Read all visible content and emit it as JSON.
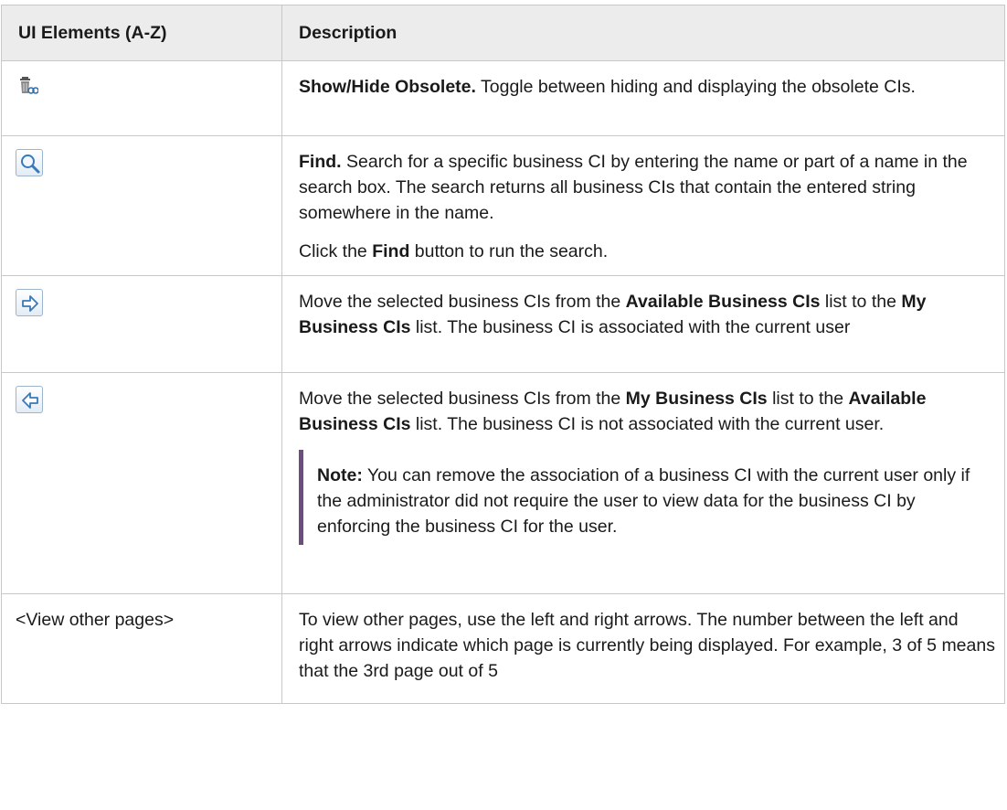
{
  "table": {
    "headers": {
      "col1": "UI Elements (A-Z)",
      "col2": "Description"
    },
    "rows": [
      {
        "icon": "show-hide-obsolete-icon",
        "term": "Show/Hide Obsolete.",
        "text": " Toggle between hiding and displaying the obsolete CIs."
      },
      {
        "icon": "find-magnifier-icon",
        "term": "Find.",
        "text": " Search for a specific business CI by entering the name or part of a name in the search box. The search returns all business CIs that contain the entered string somewhere in the name.",
        "p2_pre": "Click the ",
        "p2_bold": "Find",
        "p2_post": " button to run the search."
      },
      {
        "icon": "arrow-right-icon",
        "t1": "Move the selected business CIs from the ",
        "b1": "Available Business CIs",
        "t2": " list to the ",
        "b2": "My Business CIs",
        "t3": " list. The business CI is associated with the current user"
      },
      {
        "icon": "arrow-left-icon",
        "t1": "Move the selected business CIs from the ",
        "b1": "My Business CIs",
        "t2": " list to the ",
        "b2": "Available Business CIs",
        "t3": " list. The business CI is not associated with the current user.",
        "note_label": "Note:",
        "note_text": "  You can remove the association of a business CI with the current user only if the administrator did not require the user to view data for the business CI by enforcing the business CI for the user."
      },
      {
        "element": "<View other pages>",
        "text": "To view other pages, use the left and right arrows. The number between the left and right arrows indicate which page is currently being displayed. For example, 3 of 5 means that the 3rd page out of 5"
      }
    ]
  },
  "colors": {
    "header_bg": "#ececec",
    "border": "#c8c8c8",
    "note_bar": "#6b4e7e",
    "icon_blue": "#3a78b8"
  }
}
